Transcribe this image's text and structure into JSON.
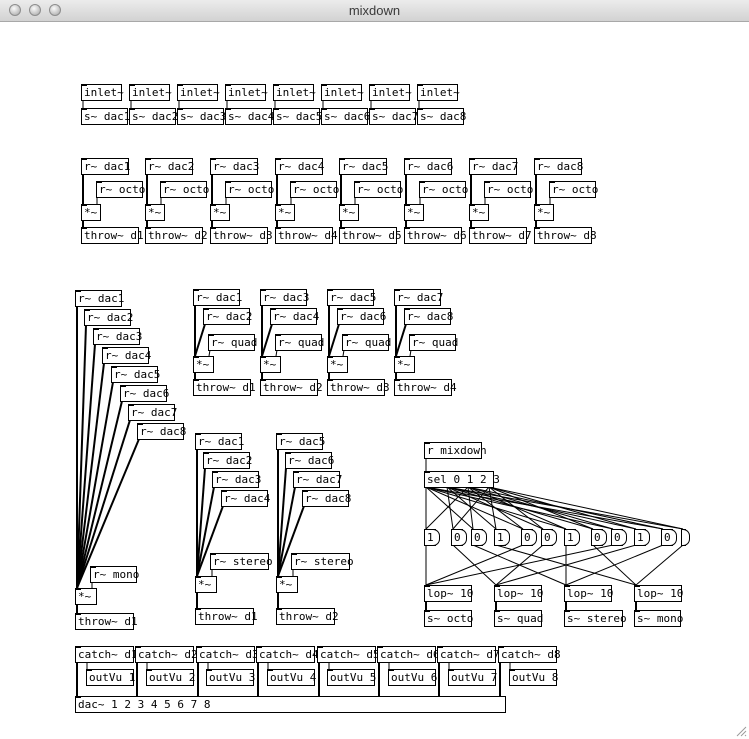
{
  "window": {
    "title": "mixdown"
  },
  "row1": {
    "inlets": [
      "inlet~",
      "inlet~",
      "inlet~",
      "inlet~",
      "inlet~",
      "inlet~",
      "inlet~",
      "inlet~"
    ],
    "sends": [
      "s~ dac1",
      "s~ dac2",
      "s~ dac3",
      "s~ dac4",
      "s~ dac5",
      "s~ dac6",
      "s~ dac7",
      "s~ dac8"
    ]
  },
  "octo": {
    "receives": [
      "r~ dac1",
      "r~ dac2",
      "r~ dac3",
      "r~ dac4",
      "r~ dac5",
      "r~ dac6",
      "r~ dac7",
      "r~ dac8"
    ],
    "gain": "r~ octo",
    "mul": "*~",
    "throws": [
      "throw~ d1",
      "throw~ d2",
      "throw~ d3",
      "throw~ d4",
      "throw~ d5",
      "throw~ d6",
      "throw~ d7",
      "throw~ d8"
    ]
  },
  "mono": {
    "receives": [
      "r~ dac1",
      "r~ dac2",
      "r~ dac3",
      "r~ dac4",
      "r~ dac5",
      "r~ dac6",
      "r~ dac7",
      "r~ dac8"
    ],
    "gain": "r~ mono",
    "mul": "*~",
    "throw": "throw~ d1"
  },
  "quad": {
    "groups": [
      {
        "a": "r~ dac1",
        "b": "r~ dac2",
        "gain": "r~ quad",
        "mul": "*~",
        "throw": "throw~ d1"
      },
      {
        "a": "r~ dac3",
        "b": "r~ dac4",
        "gain": "r~ quad",
        "mul": "*~",
        "throw": "throw~ d2"
      },
      {
        "a": "r~ dac5",
        "b": "r~ dac6",
        "gain": "r~ quad",
        "mul": "*~",
        "throw": "throw~ d3"
      },
      {
        "a": "r~ dac7",
        "b": "r~ dac8",
        "gain": "r~ quad",
        "mul": "*~",
        "throw": "throw~ d4"
      }
    ]
  },
  "stereo": {
    "groups": [
      {
        "receives": [
          "r~ dac1",
          "r~ dac2",
          "r~ dac3",
          "r~ dac4"
        ],
        "gain": "r~ stereo",
        "mul": "*~",
        "throw": "throw~ d1"
      },
      {
        "receives": [
          "r~ dac5",
          "r~ dac6",
          "r~ dac7",
          "r~ dac8"
        ],
        "gain": "r~ stereo",
        "mul": "*~",
        "throw": "throw~ d2"
      }
    ]
  },
  "control": {
    "receive": "r mixdown",
    "select": "sel 0 1 2 3",
    "msgs": [
      "1",
      "0",
      "0",
      "1",
      "0",
      "0",
      "1",
      "0",
      "0",
      "1",
      "0",
      "0"
    ],
    "lops": [
      "lop~ 10",
      "lop~ 10",
      "lop~ 10",
      "lop~ 10"
    ],
    "sends": [
      "s~ octo",
      "s~ quad",
      "s~ stereo",
      "s~ mono"
    ]
  },
  "output": {
    "catches": [
      "catch~ d1",
      "catch~ d2",
      "catch~ d3",
      "catch~ d4",
      "catch~ d5",
      "catch~ d6",
      "catch~ d7",
      "catch~ d8"
    ],
    "meters": [
      "outVu 1",
      "outVu 2",
      "outVu 3",
      "outVu 4",
      "outVu 5",
      "outVu 6",
      "outVu 7",
      "outVu 8"
    ],
    "dac": "dac~ 1 2 3 4 5 6 7 8"
  },
  "colors": {
    "patch_bg": "#ffffff",
    "ink": "#000000",
    "titlebar": "#dcdcdc"
  }
}
